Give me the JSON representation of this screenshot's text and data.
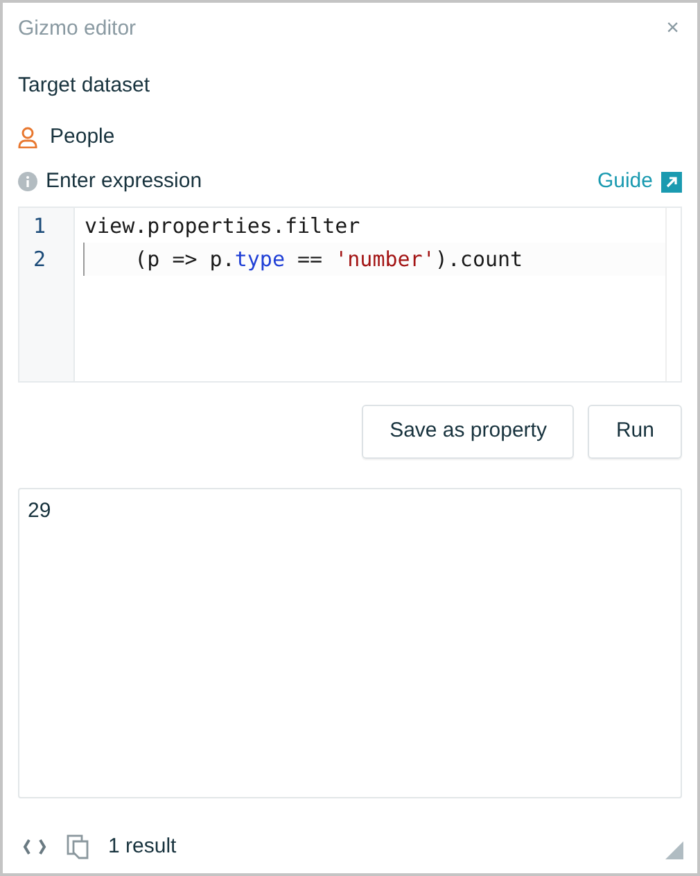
{
  "window": {
    "title": "Gizmo editor",
    "close": "×"
  },
  "target": {
    "label": "Target dataset",
    "dataset": "People"
  },
  "expression": {
    "label": "Enter expression",
    "guide": "Guide"
  },
  "editor": {
    "lines": [
      {
        "number": "1",
        "active": false,
        "tokens": [
          {
            "text": "view.properties.filter",
            "kind": "plain"
          }
        ]
      },
      {
        "number": "2",
        "active": true,
        "tokens": [
          {
            "text": "    (p => p.",
            "kind": "plain"
          },
          {
            "text": "type",
            "kind": "keyword"
          },
          {
            "text": " == ",
            "kind": "plain"
          },
          {
            "text": "'number'",
            "kind": "string"
          },
          {
            "text": ").count",
            "kind": "plain"
          }
        ]
      }
    ]
  },
  "buttons": [
    "Save as property",
    "Run"
  ],
  "output": {
    "value": "29"
  },
  "footer": {
    "count": "1 result"
  }
}
